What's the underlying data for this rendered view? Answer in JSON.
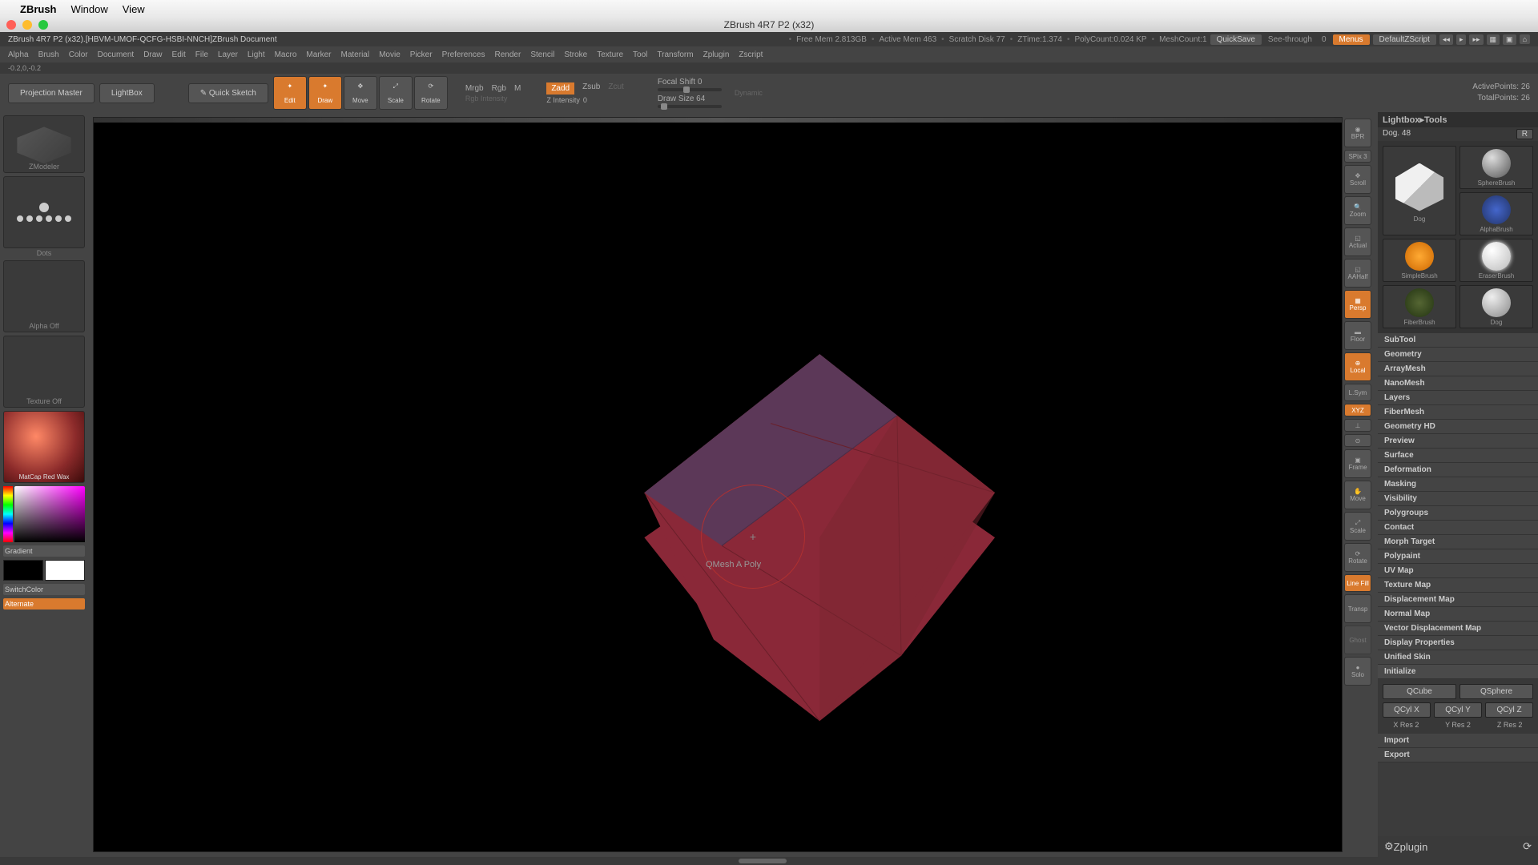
{
  "mac_menu": {
    "apple": "",
    "app_name": "ZBrush",
    "items": [
      "Window",
      "View"
    ]
  },
  "window_title": "ZBrush 4R7 P2 (x32)",
  "status": {
    "doc": "ZBrush 4R7 P2 (x32).[HBVM-UMOF-QCFG-HSBI-NNCH]ZBrush Document",
    "stats": [
      "Free Mem 2.813GB",
      "Active Mem 463",
      "Scratch Disk 77",
      "ZTime:1.374",
      "PolyCount:0.024 KP",
      "MeshCount:1"
    ],
    "quicksave": "QuickSave",
    "seethrough_label": "See-through",
    "seethrough_val": "0",
    "menus": "Menus",
    "default_script": "DefaultZScript"
  },
  "menu2": [
    "Alpha",
    "Brush",
    "Color",
    "Document",
    "Draw",
    "Edit",
    "File",
    "Layer",
    "Light",
    "Macro",
    "Marker",
    "Material",
    "Movie",
    "Picker",
    "Preferences",
    "Render",
    "Stencil",
    "Stroke",
    "Texture",
    "Tool",
    "Transform",
    "Zplugin",
    "Zscript"
  ],
  "coord": "-0.2,0,-0.2",
  "toolbar": {
    "projection": "Projection Master",
    "lightbox": "LightBox",
    "quicksketch": "Quick Sketch",
    "edit": "Edit",
    "draw": "Draw",
    "move": "Move",
    "scale": "Scale",
    "rotate": "Rotate",
    "mrgb": "Mrgb",
    "rgb": "Rgb",
    "m": "M",
    "rgb_intensity": "Rgb Intensity",
    "zadd": "Zadd",
    "zsub": "Zsub",
    "zcut": "Zcut",
    "z_intensity": "Z Intensity",
    "z_intensity_val": "0",
    "focal_shift": "Focal Shift",
    "focal_val": "0",
    "draw_size": "Draw Size",
    "draw_size_val": "64",
    "dynamic": "Dynamic",
    "active_points": "ActivePoints: 26",
    "total_points": "TotalPoints: 26"
  },
  "left": {
    "zmodeler": "ZModeler",
    "dots": "Dots",
    "alpha_off": "Alpha Off",
    "texture_off": "Texture Off",
    "material": "MatCap Red Wax",
    "gradient": "Gradient",
    "switchcolor": "SwitchColor",
    "alternate": "Alternate"
  },
  "cursor_label": "QMesh A Poly",
  "right_tools": [
    "BPR",
    "SPix 3",
    "Scroll",
    "Zoom",
    "Actual",
    "AAHalf",
    "Persp",
    "Floor",
    "Local",
    "L.Sym",
    "XYZ",
    "Frame",
    "Move",
    "Scale",
    "Rotate",
    "Line Fill",
    "Transp",
    "Ghost",
    "Solo"
  ],
  "right_panel": {
    "title": "Lightbox▸Tools",
    "subtool_name": "Dog",
    "subtool_count": "48",
    "r_btn": "R",
    "tools": [
      "Dog",
      "SphereBrush",
      "AlphaBrush",
      "SimpleBrush",
      "EraserBrush",
      "FiberBrush",
      "Dog"
    ],
    "sections": [
      "SubTool",
      "Geometry",
      "ArrayMesh",
      "NanoMesh",
      "Layers",
      "FiberMesh",
      "Geometry HD",
      "Preview",
      "Surface",
      "Deformation",
      "Masking",
      "Visibility",
      "Polygroups",
      "Contact",
      "Morph Target",
      "Polypaint",
      "UV Map",
      "Texture Map",
      "Displacement Map",
      "Normal Map",
      "Vector Displacement Map",
      "Display Properties",
      "Unified Skin"
    ],
    "init": {
      "title": "Initialize",
      "qcube": "QCube",
      "qsphere": "QSphere",
      "qcylx": "QCyl X",
      "qcyly": "QCyl Y",
      "qcylz": "QCyl Z",
      "xres": "X Res 2",
      "yres": "Y Res 2",
      "zres": "Z Res 2"
    },
    "import": "Import",
    "export": "Export",
    "zplugin": "Zplugin"
  }
}
